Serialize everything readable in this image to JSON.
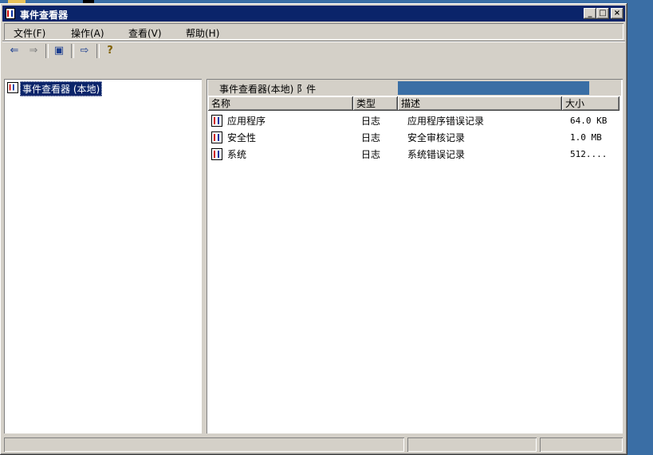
{
  "window": {
    "title": "事件查看器"
  },
  "titlebar_buttons": {
    "minimize": "_",
    "maximize": "□",
    "close": "×"
  },
  "menu": [
    {
      "label": "文件(F)"
    },
    {
      "label": "操作(A)"
    },
    {
      "label": "查看(V)"
    },
    {
      "label": "帮助(H)"
    }
  ],
  "toolbar": {
    "back_icon": "⇐",
    "forward_icon": "⇒",
    "show_hide_tree_icon": "▣",
    "export_icon": "⇨",
    "help_icon": "?"
  },
  "tree": {
    "root_label": "事件查看器 (本地)"
  },
  "right_pane": {
    "header": "事件查看器(本地)   阝件",
    "columns": [
      "名称",
      "类型",
      "描述",
      "大小"
    ],
    "rows": [
      {
        "name": "应用程序",
        "type": "日志",
        "desc": "应用程序错误记录",
        "size": "64.0 KB"
      },
      {
        "name": "安全性",
        "type": "日志",
        "desc": "安全审核记录",
        "size": "1.0 MB"
      },
      {
        "name": "系统",
        "type": "日志",
        "desc": "系统错误记录",
        "size": "512...."
      }
    ]
  },
  "colors": {
    "titlebar": "#0a246a",
    "desktop": "#3a6ea5",
    "face": "#d4d0c8"
  }
}
